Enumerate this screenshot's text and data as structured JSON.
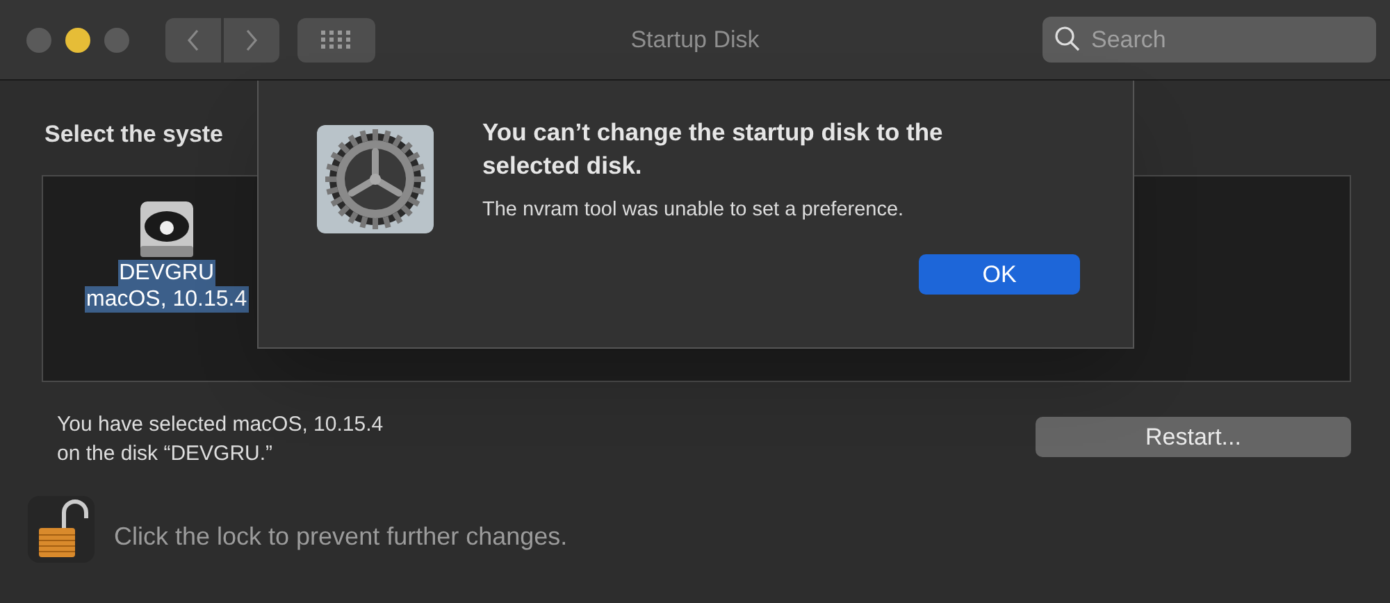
{
  "window": {
    "title": "Startup Disk",
    "traffic_lights": [
      {
        "color": "#5a5a5a"
      },
      {
        "color": "#e6bd37"
      },
      {
        "color": "#5a5a5a"
      }
    ]
  },
  "toolbar": {
    "search": {
      "placeholder": "Search"
    }
  },
  "heading": "Select the syste",
  "disks": [
    {
      "name": "DEVGRU",
      "system": "macOS, 10.15.4",
      "selected": true
    }
  ],
  "selection_text": [
    "You have selected macOS, 10.15.4",
    "on the disk “DEVGRU.”"
  ],
  "restart_button": "Restart...",
  "lock": {
    "locked": false,
    "text": "Click the lock to prevent further changes."
  },
  "alert": {
    "title": "You can’t change the startup disk to the selected disk.",
    "message": "The nvram tool was unable to set a preference.",
    "button": "OK"
  }
}
